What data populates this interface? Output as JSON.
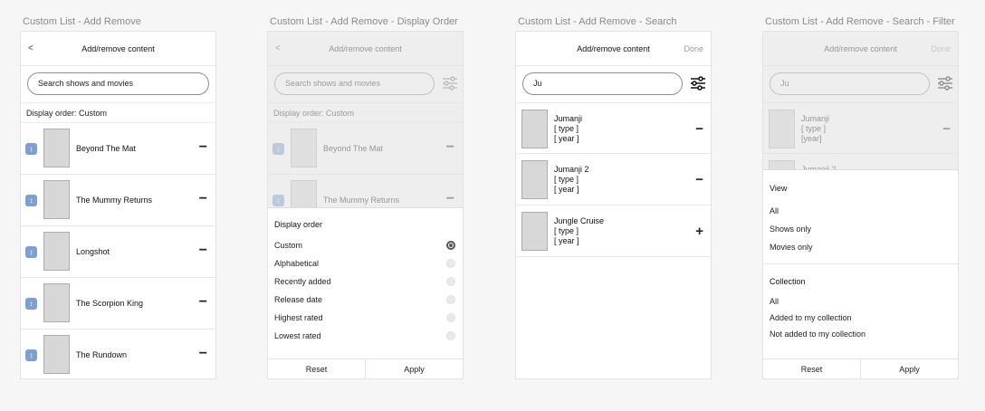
{
  "screens": [
    {
      "label": "Custom List - Add Remove",
      "header_title": "Add/remove content",
      "back": "<",
      "search_placeholder": "Search shows and movies",
      "display_order": "Display order: Custom",
      "items": [
        {
          "title": "Beyond The Mat",
          "action": "−"
        },
        {
          "title": "The Mummy Returns",
          "action": "−"
        },
        {
          "title": "Longshot",
          "action": "−"
        },
        {
          "title": "The Scorpion King",
          "action": "−"
        },
        {
          "title": "The Rundown",
          "action": "−"
        }
      ]
    },
    {
      "label": "Custom List - Add Remove - Display Order",
      "header_title": "Add/remove content",
      "back": "<",
      "search_placeholder": "Search shows and movies",
      "display_order": "Display order: Custom",
      "items": [
        {
          "title": "Beyond The Mat",
          "action": "−"
        },
        {
          "title": "The Mummy Returns",
          "action": "−"
        }
      ],
      "sheet": {
        "title": "Display order",
        "options": [
          {
            "label": "Custom",
            "selected": true
          },
          {
            "label": "Alphabetical",
            "selected": false
          },
          {
            "label": "Recently added",
            "selected": false
          },
          {
            "label": "Release date",
            "selected": false
          },
          {
            "label": "Highest rated",
            "selected": false
          },
          {
            "label": "Lowest rated",
            "selected": false
          }
        ],
        "reset": "Reset",
        "apply": "Apply"
      }
    },
    {
      "label": "Custom List - Add Remove - Search",
      "header_title": "Add/remove content",
      "done": "Done",
      "search_value": "Ju",
      "results": [
        {
          "title": "Jumanji",
          "type": "[ type ]",
          "year": "[ year ]",
          "action": "−"
        },
        {
          "title": "Jumanji 2",
          "type": "[ type ]",
          "year": "[ year ]",
          "action": "−"
        },
        {
          "title": "Jungle Cruise",
          "type": "[ type ]",
          "year": "[ year ]",
          "action": "+"
        }
      ]
    },
    {
      "label": "Custom List - Add Remove - Search - Filter",
      "header_title": "Add/remove content",
      "done": "Done",
      "search_value": "Ju",
      "results": [
        {
          "title": "Jumanji",
          "type": "[ type ]",
          "year": "[year]",
          "action": "−"
        },
        {
          "title": "Jumanji 2"
        }
      ],
      "sheet": {
        "view_title": "View",
        "view_options": [
          "All",
          "Shows only",
          "Movies only"
        ],
        "collection_title": "Collection",
        "collection_options": [
          "All",
          "Added to my collection",
          "Not added to my collection"
        ],
        "reset": "Reset",
        "apply": "Apply"
      }
    }
  ],
  "icons": {
    "handle": "drag-handle-icon",
    "filter": "sliders-icon"
  },
  "colors": {
    "handle": "#7d9fd2",
    "thumb": "#d7d7d7"
  }
}
